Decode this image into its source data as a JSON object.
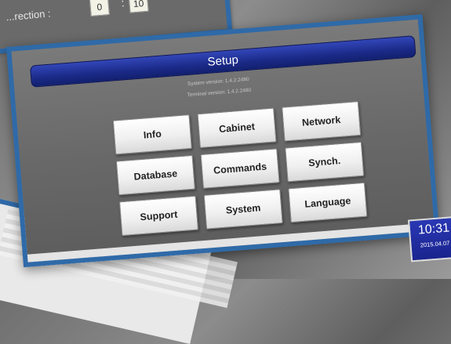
{
  "background_panel": {
    "label": "...rection :",
    "value_a": "0",
    "value_b": "10",
    "separator": ":"
  },
  "setup": {
    "title": "Setup",
    "system_version": "System version: 1.4.2.2480",
    "terminal_version": "Terminal version: 1.4.2.2480",
    "buttons": [
      {
        "label": "Info"
      },
      {
        "label": "Cabinet"
      },
      {
        "label": "Network"
      },
      {
        "label": "Database"
      },
      {
        "label": "Commands"
      },
      {
        "label": "Synch."
      },
      {
        "label": "Support"
      },
      {
        "label": "System"
      },
      {
        "label": "Language"
      }
    ]
  },
  "clock": {
    "time": "10:31",
    "date": "2015.04.07"
  },
  "colors": {
    "frame": "#2f6aa8",
    "title_bar": "#1b2a88",
    "screen_bg": "#6a6a6a",
    "button": "#f0f0f0"
  }
}
